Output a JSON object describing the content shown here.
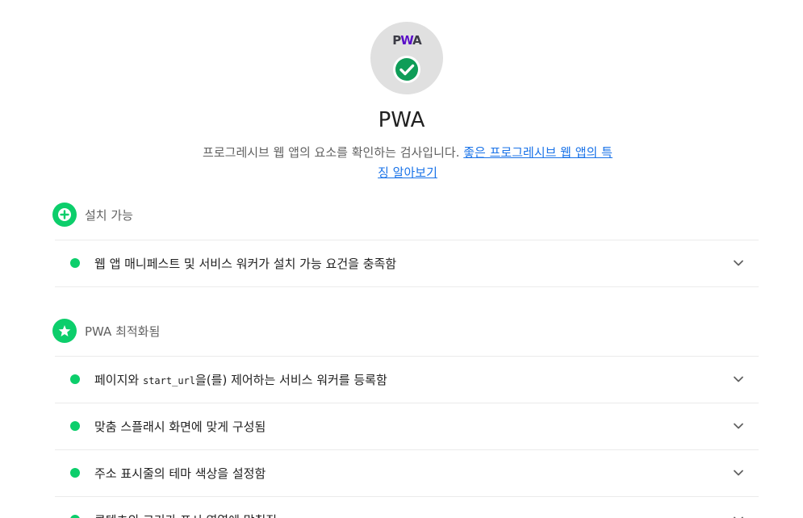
{
  "gauge": {
    "logo_p": "P",
    "logo_w": "W",
    "logo_a": "A",
    "icon": "check-circle-icon",
    "color": "#0cce6b"
  },
  "category": {
    "title": "PWA",
    "description": "프로그레시브 웹 앱의 요소를 확인하는 검사입니다.",
    "learn_more_link": "좋은 프로그레시브 웹 앱의 특징 알아보기"
  },
  "groups": [
    {
      "title": "설치 가능",
      "icon": "plus-icon",
      "audits": [
        {
          "label": "웹 앱 매니페스트 및 서비스 워커가 설치 가능 요건을 충족함",
          "status": "pass"
        }
      ]
    },
    {
      "title": "PWA 최적화됨",
      "icon": "star-icon",
      "audits": [
        {
          "label_before": "페이지와 ",
          "label_code": "start_url",
          "label_after": "을(를) 제어하는 서비스 워커를 등록함",
          "status": "pass"
        },
        {
          "label": "맞춤 스플래시 화면에 맞게 구성됨",
          "status": "pass"
        },
        {
          "label": "주소 표시줄의 테마 색상을 설정함",
          "status": "pass"
        },
        {
          "label": "콘텐츠의 크기가 표시 영역에 맞춰짐",
          "status": "pass"
        }
      ]
    }
  ],
  "colors": {
    "pass": "#0cce6b",
    "link": "#1a73e8"
  }
}
